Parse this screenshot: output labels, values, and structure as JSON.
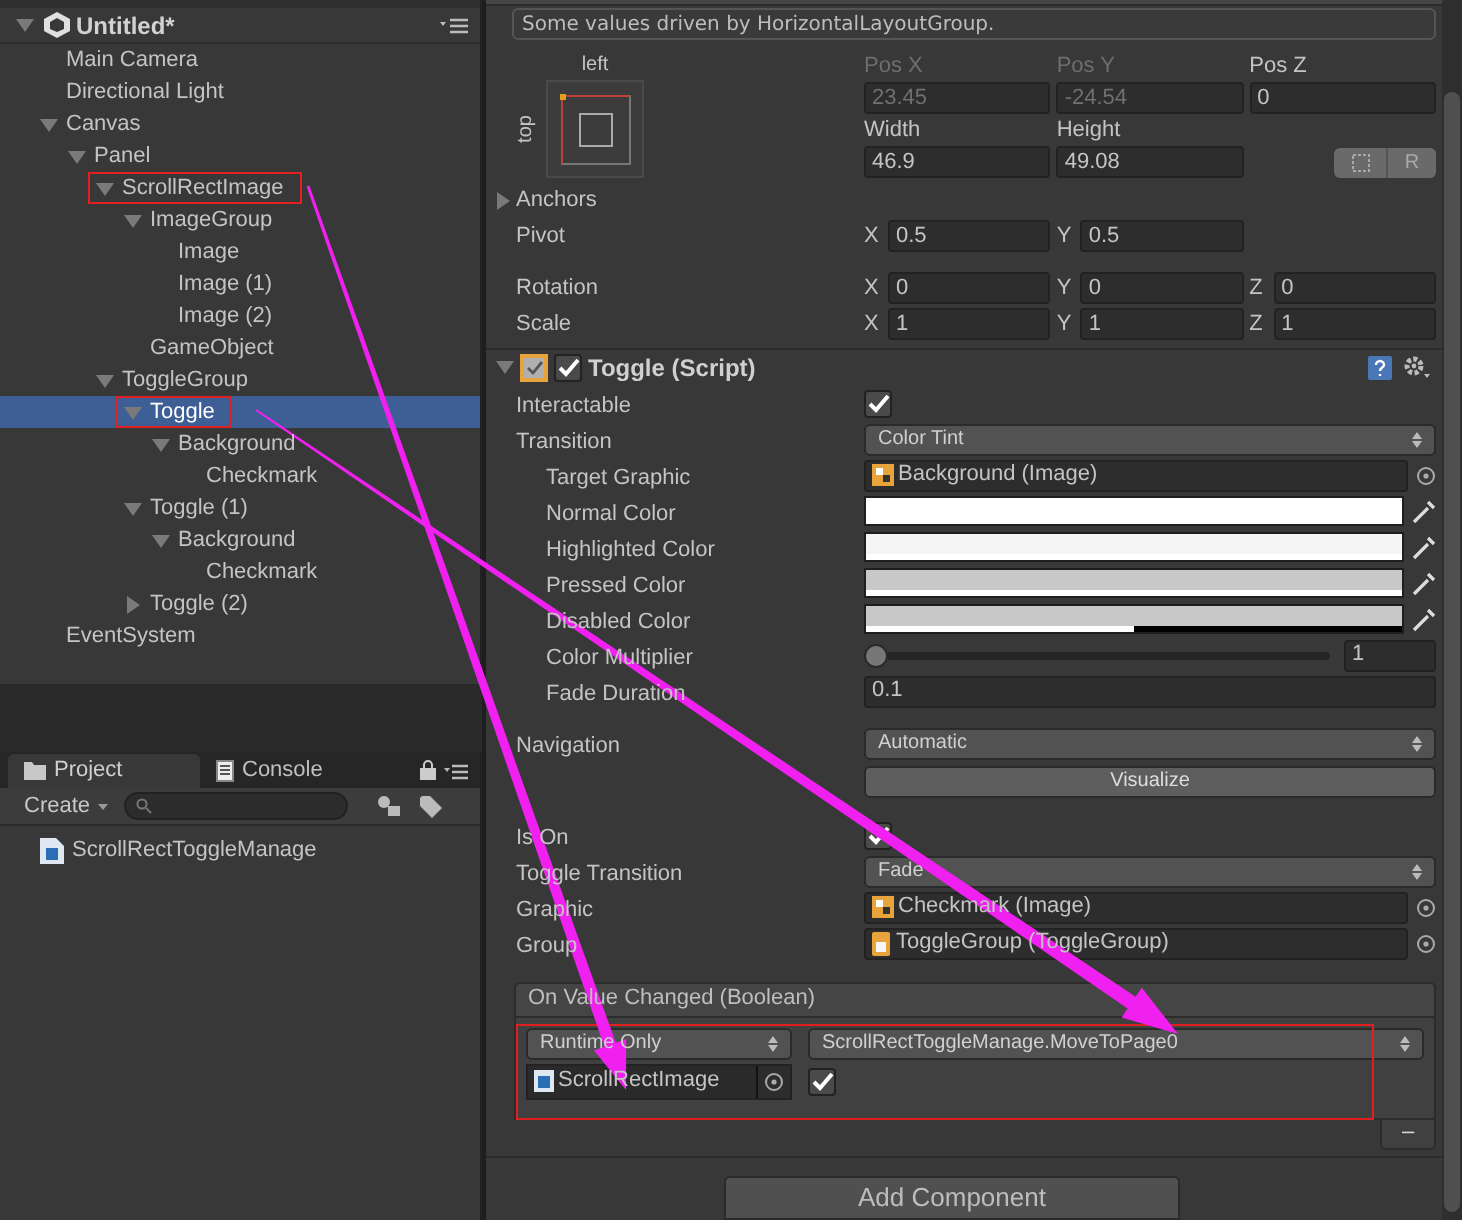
{
  "hierarchy": {
    "title": "Untitled*",
    "items": [
      {
        "label": "Main Camera",
        "selected": false,
        "annotated": false
      },
      {
        "label": "Directional Light",
        "selected": false,
        "annotated": false
      },
      {
        "label": "Canvas",
        "expanded": true,
        "selected": false,
        "annotated": false,
        "children": [
          {
            "label": "Panel",
            "expanded": true,
            "selected": false,
            "annotated": false,
            "children": [
              {
                "label": "ScrollRectImage",
                "expanded": true,
                "selected": false,
                "annotated": true,
                "children": [
                  {
                    "label": "ImageGroup",
                    "expanded": true,
                    "selected": false,
                    "annotated": false,
                    "children": [
                      {
                        "label": "Image",
                        "selected": false,
                        "annotated": false
                      },
                      {
                        "label": "Image (1)",
                        "selected": false,
                        "annotated": false
                      },
                      {
                        "label": "Image (2)",
                        "selected": false,
                        "annotated": false
                      }
                    ]
                  },
                  {
                    "label": "GameObject",
                    "selected": false,
                    "annotated": false
                  }
                ]
              },
              {
                "label": "ToggleGroup",
                "expanded": true,
                "selected": false,
                "annotated": false,
                "children": [
                  {
                    "label": "Toggle",
                    "expanded": true,
                    "selected": true,
                    "annotated": true,
                    "children": [
                      {
                        "label": "Background",
                        "expanded": true,
                        "selected": false,
                        "annotated": false,
                        "children": [
                          {
                            "label": "Checkmark",
                            "selected": false,
                            "annotated": false
                          }
                        ]
                      }
                    ]
                  },
                  {
                    "label": "Toggle (1)",
                    "expanded": true,
                    "selected": false,
                    "annotated": false,
                    "children": [
                      {
                        "label": "Background",
                        "expanded": true,
                        "selected": false,
                        "annotated": false,
                        "children": [
                          {
                            "label": "Checkmark",
                            "selected": false,
                            "annotated": false
                          }
                        ]
                      }
                    ]
                  },
                  {
                    "label": "Toggle (2)",
                    "expanded": false,
                    "selected": false,
                    "annotated": false
                  }
                ]
              }
            ]
          }
        ]
      },
      {
        "label": "EventSystem",
        "selected": false,
        "annotated": false
      }
    ]
  },
  "project": {
    "tabs": [
      {
        "label": "Project",
        "selected": true
      },
      {
        "label": "Console",
        "selected": false
      }
    ],
    "create_button": "Create",
    "assets": [
      {
        "name": "ScrollRectToggleManage"
      }
    ]
  },
  "inspector": {
    "rect_transform": {
      "notice": "Some values driven by HorizontalLayoutGroup.",
      "anchor_horizontal": "left",
      "anchor_vertical": "top",
      "position": [
        {
          "label": "Pos X",
          "value": "23.45",
          "disabled": true
        },
        {
          "label": "Pos Y",
          "value": "-24.54",
          "disabled": true
        },
        {
          "label": "Pos Z",
          "value": "0",
          "disabled": false
        }
      ],
      "size": [
        {
          "label": "Width",
          "value": "46.9"
        },
        {
          "label": "Height",
          "value": "49.08"
        }
      ],
      "raw_button": "R",
      "anchors": {
        "label": "Anchors",
        "expanded": false
      },
      "vectors": [
        {
          "label": "Pivot",
          "components": [
            {
              "axis": "X",
              "value": "0.5"
            },
            {
              "axis": "Y",
              "value": "0.5"
            }
          ]
        },
        {
          "label": "Rotation",
          "components": [
            {
              "axis": "X",
              "value": "0"
            },
            {
              "axis": "Y",
              "value": "0"
            },
            {
              "axis": "Z",
              "value": "0"
            }
          ]
        },
        {
          "label": "Scale",
          "components": [
            {
              "axis": "X",
              "value": "1"
            },
            {
              "axis": "Y",
              "value": "1"
            },
            {
              "axis": "Z",
              "value": "1"
            }
          ]
        }
      ]
    },
    "toggle": {
      "title": "Toggle (Script)",
      "expanded": true,
      "enabled": true,
      "properties": [
        {
          "kind": "checkbox",
          "label": "Interactable",
          "checked": true
        },
        {
          "kind": "dropdown",
          "label": "Transition",
          "value": "Color Tint",
          "children": [
            {
              "kind": "image_object",
              "label": "Target Graphic",
              "value": "Background (Image)"
            },
            {
              "kind": "color",
              "label": "Normal Color",
              "color": "#ffffff",
              "level": 1
            },
            {
              "kind": "color",
              "label": "Highlighted Color",
              "color": "#f5f5f5",
              "level": 1
            },
            {
              "kind": "color",
              "label": "Pressed Color",
              "color": "#c8c8c8",
              "level": 1
            },
            {
              "kind": "color",
              "label": "Disabled Color",
              "color": "#c8c8c8",
              "level": 0.5
            },
            {
              "kind": "slider",
              "label": "Color Multiplier",
              "level": 0,
              "value": "1"
            },
            {
              "kind": "number",
              "label": "Fade Duration",
              "value": "0.1"
            }
          ]
        },
        {
          "kind": "dropdown",
          "label": "Navigation",
          "value": "Automatic"
        },
        {
          "kind": "button",
          "label": "Visualize"
        },
        {
          "kind": "checkbox",
          "label": "Is On",
          "checked": true
        },
        {
          "kind": "dropdown",
          "label": "Toggle Transition",
          "value": "Fade"
        },
        {
          "kind": "image_object",
          "label": "Graphic",
          "value": "Checkmark (Image)"
        },
        {
          "kind": "component_object",
          "label": "Group",
          "value": "ToggleGroup (ToggleGroup)"
        }
      ]
    },
    "event": {
      "title": "On Value Changed (Boolean)",
      "listeners": [
        {
          "mode": "Runtime Only",
          "function": "ScrollRectToggleManage.MoveToPage0",
          "target": "ScrollRectImage",
          "checked": true,
          "annotated": true
        }
      ],
      "remove_button": "–"
    },
    "add_component": "Add Component"
  }
}
